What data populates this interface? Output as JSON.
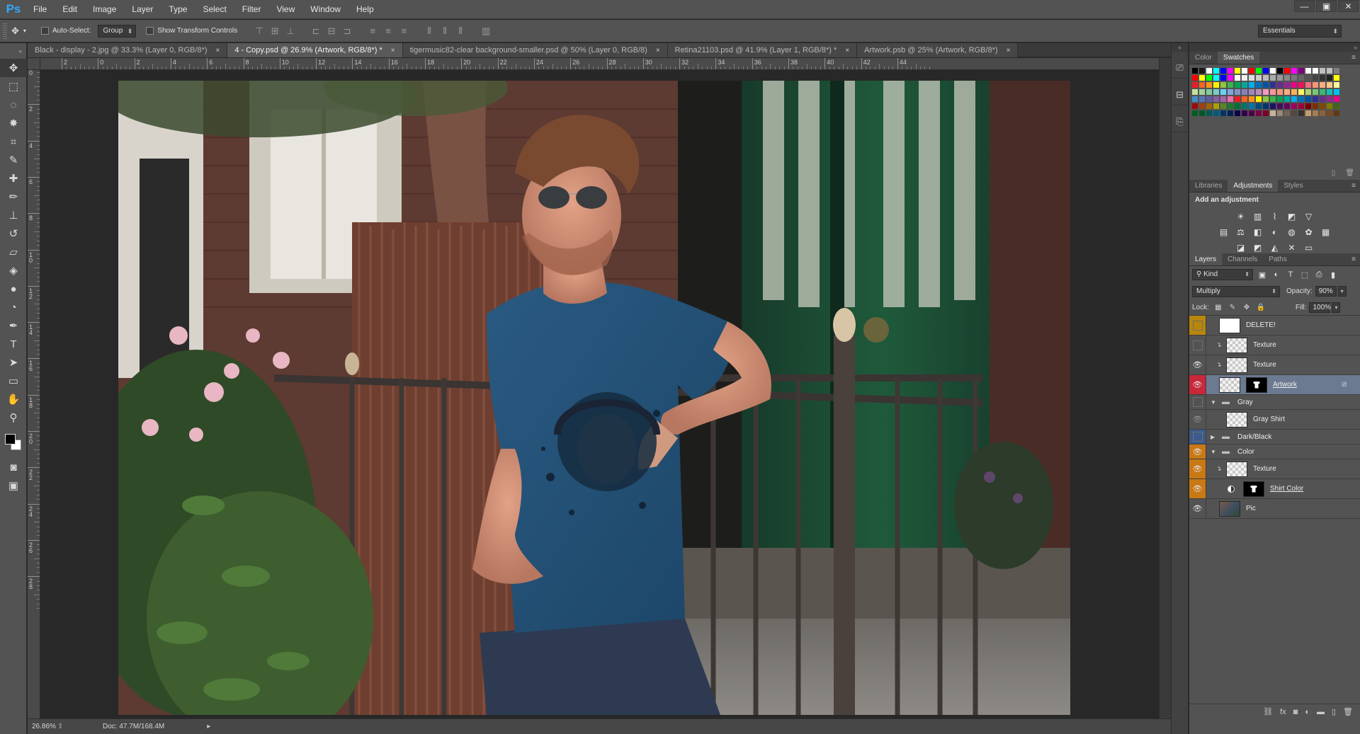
{
  "app": {
    "logo": "Ps"
  },
  "menu": [
    "File",
    "Edit",
    "Image",
    "Layer",
    "Type",
    "Select",
    "Filter",
    "View",
    "Window",
    "Help"
  ],
  "window_controls": {
    "minimize": "—",
    "restore": "▣",
    "close": "✕"
  },
  "options_bar": {
    "tool_preset_icon": "move-tool-icon",
    "auto_select_label": "Auto-Select:",
    "auto_select_value": "Group",
    "transform_label": "Show Transform Controls",
    "workspace": "Essentials"
  },
  "tabs": [
    {
      "label": "Black - display - 2.jpg @ 33.3% (Layer 0, RGB/8*)",
      "active": false
    },
    {
      "label": "4 - Copy.psd @ 26.9% (Artwork, RGB/8*) *",
      "active": true
    },
    {
      "label": "tigermusic82-clear background-smaller.psd @ 50% (Layer 0, RGB/8)",
      "active": false
    },
    {
      "label": "Retina21103.psd @ 41.9% (Layer 1, RGB/8*) *",
      "active": false
    },
    {
      "label": "Artwork.psb @ 25% (Artwork, RGB/8*)",
      "active": false
    }
  ],
  "ruler_h": [
    "2",
    "0",
    "2",
    "4",
    "6",
    "8",
    "10",
    "12",
    "14",
    "16",
    "18",
    "20",
    "22",
    "24",
    "26",
    "28",
    "30",
    "32",
    "34",
    "36",
    "38",
    "40",
    "42",
    "44"
  ],
  "ruler_v": [
    "0",
    "2",
    "4",
    "6",
    "8",
    "10",
    "12",
    "14",
    "16",
    "18",
    "20",
    "22",
    "24",
    "26",
    "28"
  ],
  "status": {
    "zoom": "26.86%",
    "doc": "Doc: 47.7M/168.4M"
  },
  "panels": {
    "top_tabs": [
      "Color",
      "Swatches"
    ],
    "top_active": "Swatches",
    "adjust_tabs": [
      "Libraries",
      "Adjustments",
      "Styles"
    ],
    "adjust_active": "Adjustments",
    "adjust_title": "Add an adjustment",
    "layers_tabs": [
      "Layers",
      "Channels",
      "Paths"
    ],
    "layers_active": "Layers"
  },
  "layers_panel": {
    "filter_kind": "Kind",
    "blend_mode": "Multiply",
    "opacity_label": "Opacity:",
    "opacity": "90%",
    "lock_label": "Lock:",
    "fill_label": "Fill:",
    "fill": "100%",
    "layers": [
      {
        "name": "DELETE!",
        "thumb": "white",
        "vis": "none",
        "tag": "#b8860b",
        "depth": 0
      },
      {
        "name": "Texture",
        "thumb": "checker",
        "vis": "none",
        "tag": "",
        "depth": 1,
        "link": true
      },
      {
        "name": "Texture",
        "thumb": "checker",
        "vis": "eye",
        "tag": "",
        "depth": 1,
        "link": true
      },
      {
        "name": "Artwork",
        "thumb": "checker",
        "mask": true,
        "vis": "eye",
        "tag": "#c8283a",
        "depth": 0,
        "selected": true,
        "underline": true
      },
      {
        "name": "Gray",
        "folder": true,
        "open": true,
        "vis": "none",
        "tag": "",
        "depth": 0,
        "small": true
      },
      {
        "name": "Gray Shirt",
        "thumb": "checker",
        "vis": "eye-dim",
        "tag": "",
        "depth": 1
      },
      {
        "name": "Dark/Black",
        "folder": true,
        "open": false,
        "vis": "none",
        "tag": "#3c5a8c",
        "depth": 0,
        "small": true
      },
      {
        "name": "Color",
        "folder": true,
        "open": true,
        "vis": "eye",
        "tag": "#c87814",
        "depth": 0,
        "small": true
      },
      {
        "name": "Texture",
        "thumb": "checker",
        "vis": "eye",
        "tag": "#c87814",
        "depth": 1,
        "link": true
      },
      {
        "name": "Shirt Color",
        "adj": true,
        "mask": true,
        "vis": "eye",
        "tag": "#c87814",
        "depth": 1,
        "underline": true
      },
      {
        "name": "Pic",
        "thumb": "pic",
        "vis": "eye",
        "tag": "",
        "depth": 0
      }
    ]
  },
  "swatch_colors": [
    "#000000",
    "#1a1a1a",
    "#ffffff",
    "#00ffff",
    "#0000ff",
    "#ff00ff",
    "#ffff00",
    "#ffffff",
    "#ff0000",
    "#00ff00",
    "#0000ff",
    "#ffffff",
    "#000000",
    "#ff0000",
    "#ff00ff",
    "#800080",
    "#ffffff",
    "#ffffff",
    "#c0c0c0",
    "#c0c0c0",
    "#808080",
    "#ff0000",
    "#ffff00",
    "#00ff00",
    "#00ffff",
    "#0000ff",
    "#ff00ff",
    "#ffffff",
    "#eeeeee",
    "#dddddd",
    "#cccccc",
    "#bbbbbb",
    "#aaaaaa",
    "#999999",
    "#888888",
    "#777777",
    "#666666",
    "#555555",
    "#444444",
    "#333333",
    "#222222",
    "#ffff00",
    "#ed1c24",
    "#f26522",
    "#f7941d",
    "#fff200",
    "#8dc63f",
    "#39b54a",
    "#00a651",
    "#00a99d",
    "#00aeef",
    "#0072bc",
    "#0054a6",
    "#2e3192",
    "#662d91",
    "#92278f",
    "#ec008c",
    "#ed145b",
    "#f26d7d",
    "#f69679",
    "#f9ad81",
    "#fdc689",
    "#fff799",
    "#c4df9b",
    "#a3d39c",
    "#82ca9c",
    "#7accc8",
    "#6dcff6",
    "#7da7d9",
    "#8393ca",
    "#8781bd",
    "#a186be",
    "#bd8cbf",
    "#f49ac1",
    "#f5989d",
    "#f7977a",
    "#f9ad81",
    "#fbaf5d",
    "#fff568",
    "#acd373",
    "#7cc576",
    "#3bb878",
    "#1abbb4",
    "#00bff3",
    "#438ccb",
    "#5574b9",
    "#605ca8",
    "#855fa8",
    "#a763a8",
    "#f06eaa",
    "#ed1c24",
    "#f26522",
    "#f7941d",
    "#fff200",
    "#8dc63f",
    "#39b54a",
    "#00a651",
    "#00a99d",
    "#00aeef",
    "#0072bc",
    "#0054a6",
    "#2e3192",
    "#662d91",
    "#92278f",
    "#ec008c",
    "#9e0b0f",
    "#a0410d",
    "#a3620a",
    "#aba000",
    "#598527",
    "#1a7b30",
    "#007236",
    "#00746b",
    "#0076a3",
    "#004a80",
    "#003471",
    "#1b1464",
    "#440e62",
    "#630460",
    "#9e005d",
    "#9e0039",
    "#790000",
    "#7b2e00",
    "#7d4900",
    "#827b00",
    "#406618",
    "#005e20",
    "#005826",
    "#005952",
    "#005b7f",
    "#003663",
    "#002157",
    "#0d004c",
    "#32004b",
    "#4b0049",
    "#7b0046",
    "#7a0026",
    "#c7b299",
    "#998675",
    "#736357",
    "#534741",
    "#37302d",
    "#c69c6d",
    "#a67c52",
    "#8c6239",
    "#754c24",
    "#603913"
  ],
  "adjust_icons": [
    [
      "brightness-icon",
      "levels-icon",
      "curves-icon",
      "exposure-icon",
      "gradient-triangle-icon"
    ],
    [
      "vibrance-icon",
      "hue-saturation-icon",
      "color-balance-icon",
      "bw-icon",
      "photo-filter-icon",
      "channel-mixer-icon",
      "color-lookup-icon"
    ],
    [
      "invert-icon",
      "posterize-icon",
      "threshold-icon",
      "selective-color-icon",
      "gradient-map-icon"
    ]
  ]
}
